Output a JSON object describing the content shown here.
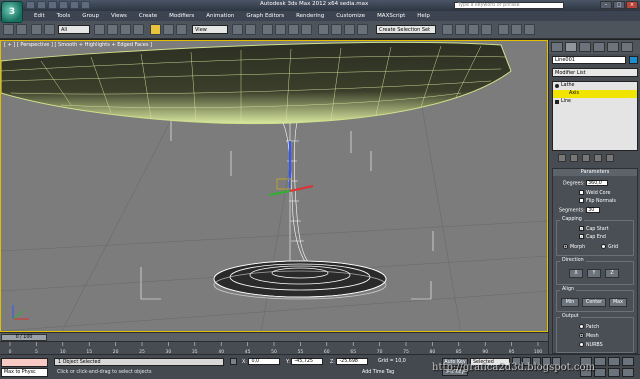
{
  "titlebar": {
    "app_title": "Autodesk 3ds Max  2012 x64     sedia.max",
    "search_placeholder": "Type a keyword or phrase"
  },
  "menubar": {
    "items": [
      "Edit",
      "Tools",
      "Group",
      "Views",
      "Create",
      "Modifiers",
      "Animation",
      "Graph Editors",
      "Rendering",
      "Customize",
      "MAXScript",
      "Help"
    ]
  },
  "toolbar": {
    "filter": "All",
    "ref_coord": "View",
    "named_selection": "Create Selection Set"
  },
  "viewport": {
    "label": "[ + ] [ Perspective ] [ Smooth + Highlights + Edged Faces ]"
  },
  "command_panel": {
    "object_name": "Line001",
    "object_color": "#1b8ecf",
    "modifier_list": "Modifier List",
    "stack": [
      "Lathe",
      "Axis",
      "Line"
    ],
    "parameters": {
      "title": "Parameters",
      "degrees_label": "Degrees:",
      "degrees_value": "360,0",
      "weld_core": "Weld Core",
      "flip_normals": "Flip Normals",
      "segments_label": "Segments:",
      "segments_value": "30",
      "capping_title": "Capping",
      "cap_start": "Cap Start",
      "cap_end": "Cap End",
      "morph": "Morph",
      "grid": "Grid",
      "direction_title": "Direction",
      "dir_x": "X",
      "dir_y": "Y",
      "dir_z": "Z",
      "align_title": "Align",
      "align_min": "Min",
      "align_center": "Center",
      "align_max": "Max",
      "output_title": "Output",
      "out_patch": "Patch",
      "out_mesh": "Mesh",
      "out_nurbs": "NURBS"
    }
  },
  "timeline": {
    "frame": "0 / 100",
    "ticks": [
      "0",
      "5",
      "10",
      "15",
      "20",
      "25",
      "30",
      "35",
      "40",
      "45",
      "50",
      "55",
      "60",
      "65",
      "70",
      "75",
      "80",
      "85",
      "90",
      "95",
      "100"
    ]
  },
  "status": {
    "maxscript": "Max to Physc",
    "selection": "1 Object Selected",
    "prompt": "Click or click-and-drag to select objects",
    "x_label": "X:",
    "x_value": "0,0",
    "y_label": "Y:",
    "y_value": "-45,725",
    "z_label": "Z:",
    "z_value": "-25,698",
    "grid": "Grid = 10,0",
    "auto_key": "Auto Key",
    "set_key": "Set Key",
    "selected": "Selected",
    "add_time_tag": "Add Time Tag"
  },
  "watermark": "http://grafica2d3d.blogspot.com"
}
